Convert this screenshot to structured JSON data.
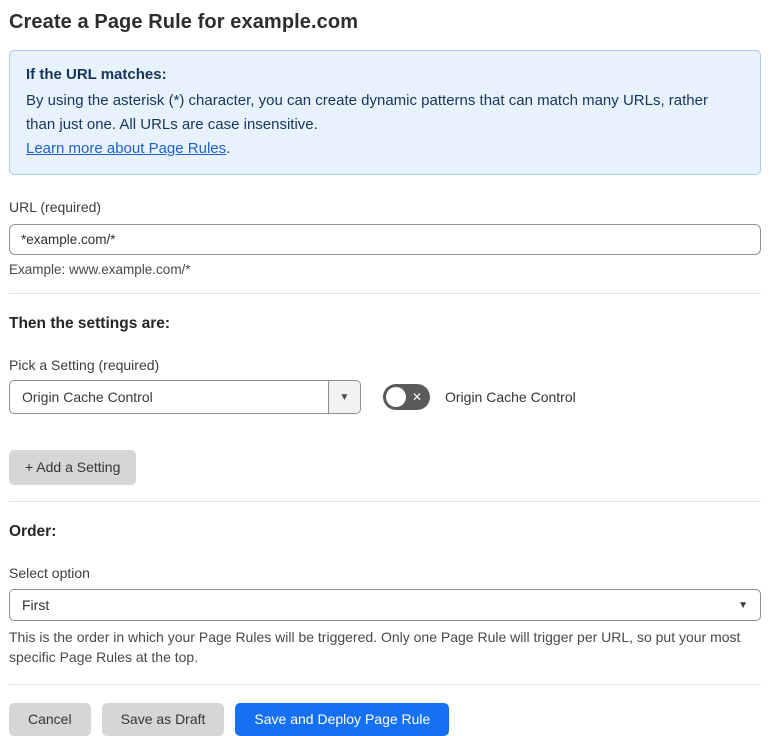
{
  "page": {
    "title": "Create a Page Rule for example.com"
  },
  "info_box": {
    "heading": "If the URL matches:",
    "body": "By using the asterisk (*) character, you can create dynamic patterns that can match many URLs, rather than just one. All URLs are case insensitive.",
    "link_label": "Learn more about Page Rules",
    "link_suffix": "."
  },
  "url_field": {
    "label": "URL (required)",
    "value": "*example.com/*",
    "example": "Example: www.example.com/*"
  },
  "settings_section": {
    "heading": "Then the settings are:",
    "picker_label": "Pick a Setting (required)",
    "picker_value": "Origin Cache Control",
    "picker_caret": "▼",
    "toggle_state": "off",
    "toggle_off_mark": "✕",
    "toggle_label": "Origin Cache Control",
    "add_setting_label": "+ Add a Setting"
  },
  "order_section": {
    "heading": "Order:",
    "select_label": "Select option",
    "select_value": "First",
    "select_caret": "▼",
    "description": "This is the order in which your Page Rules will be triggered. Only one Page Rule will trigger per URL, so put your most specific Page Rules at the top."
  },
  "footer": {
    "cancel_label": "Cancel",
    "save_draft_label": "Save as Draft",
    "save_deploy_label": "Save and Deploy Page Rule"
  },
  "colors": {
    "info_bg": "#e8f2fc",
    "info_border": "#a9cbee",
    "info_text": "#16355c",
    "link_blue": "#2160c4",
    "primary_button_blue": "#1670f3",
    "gray_button": "#d6d6d6",
    "toggle_off_gray": "#5b5b5b"
  }
}
